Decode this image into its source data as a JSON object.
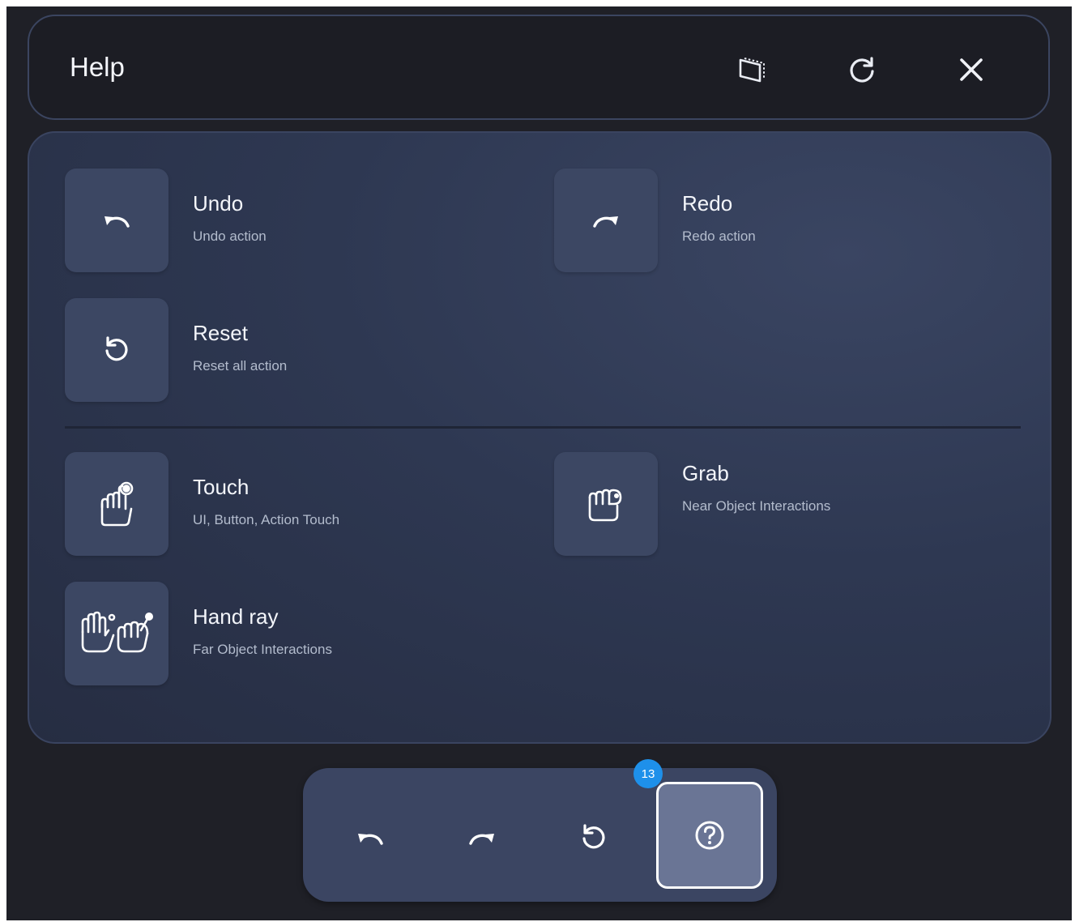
{
  "header": {
    "title": "Help",
    "buttons": [
      {
        "icon": "window-icon"
      },
      {
        "icon": "refresh-icon"
      },
      {
        "icon": "close-icon"
      }
    ]
  },
  "help_items": {
    "undo": {
      "label": "Undo",
      "description": "Undo action",
      "icon": "undo-icon"
    },
    "redo": {
      "label": "Redo",
      "description": "Redo action",
      "icon": "redo-icon"
    },
    "reset": {
      "label": "Reset",
      "description": "Reset all action",
      "icon": "reset-icon"
    },
    "touch": {
      "label": "Touch",
      "description": "UI, Button, Action Touch",
      "icon": "touch-hand-icon"
    },
    "grab": {
      "label": "Grab",
      "description": "Near Object Interactions",
      "icon": "grab-hand-icon"
    },
    "hand_ray": {
      "label": "Hand ray",
      "description": "Far Object Interactions",
      "icon": "hand-ray-icon"
    }
  },
  "toolbar": {
    "buttons": [
      {
        "icon": "undo-icon"
      },
      {
        "icon": "redo-icon"
      },
      {
        "icon": "reset-icon"
      },
      {
        "icon": "help-icon",
        "active": true
      }
    ],
    "badge": "13"
  },
  "colors": {
    "background": "#1f2027",
    "panel": "#2e3852",
    "tile": "#3c4763",
    "active_button": "#6a7595",
    "badge": "#1e90ea"
  }
}
